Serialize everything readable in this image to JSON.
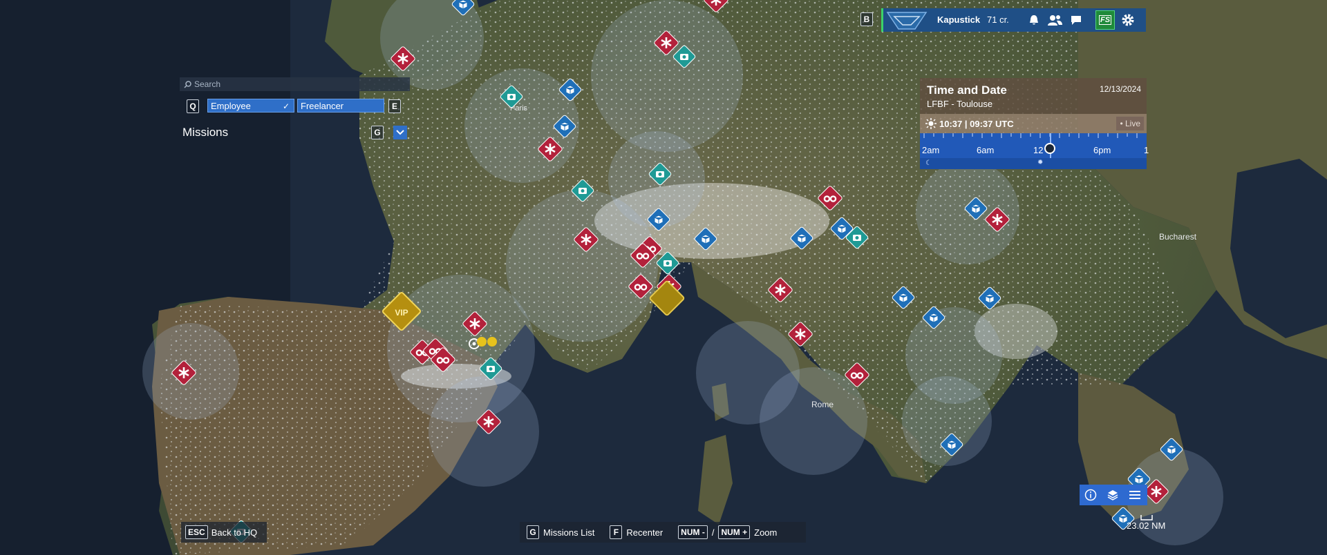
{
  "topbar": {
    "profile_key": "B",
    "username": "Kapustick",
    "credits": "71 cr.",
    "icons": [
      "bell-icon",
      "friends-icon",
      "chat-icon",
      "fs-logo-icon",
      "gear-icon"
    ],
    "fs_label": "FS"
  },
  "search": {
    "placeholder": "Search"
  },
  "filters": {
    "left_key": "Q",
    "employee_label": "Employee",
    "freelancer_label": "Freelancer",
    "right_key": "E"
  },
  "missions": {
    "title": "Missions",
    "toggle_key": "G"
  },
  "time_panel": {
    "title": "Time and Date",
    "date": "12/13/2024",
    "location": "LFBF - Toulouse",
    "time_text": "10:37 | 09:37 UTC",
    "live_label": "• Live",
    "timeline_labels": [
      "2am",
      "6am",
      "12",
      "6pm",
      "1"
    ]
  },
  "map": {
    "place_labels": [
      "Paris",
      "Rome",
      "Bucharest"
    ],
    "vip_label": "VIP",
    "scale_label": "23.02 NM"
  },
  "bottom": {
    "back_key": "ESC",
    "back_label": "Back to HQ",
    "missions_key": "G",
    "missions_label": "Missions List",
    "recenter_key": "F",
    "recenter_label": "Recenter",
    "zoom_out_key": "NUM -",
    "slash": "/",
    "zoom_in_key": "NUM +",
    "zoom_label": "Zoom"
  },
  "colors": {
    "panel_blue": "#2f6fc8",
    "rescue_red": "#b3213b",
    "cargo_blue": "#1f6fb8",
    "photo_teal": "#1f9a95",
    "vip_gold": "#b58f10",
    "online_green": "#3bd26a"
  }
}
